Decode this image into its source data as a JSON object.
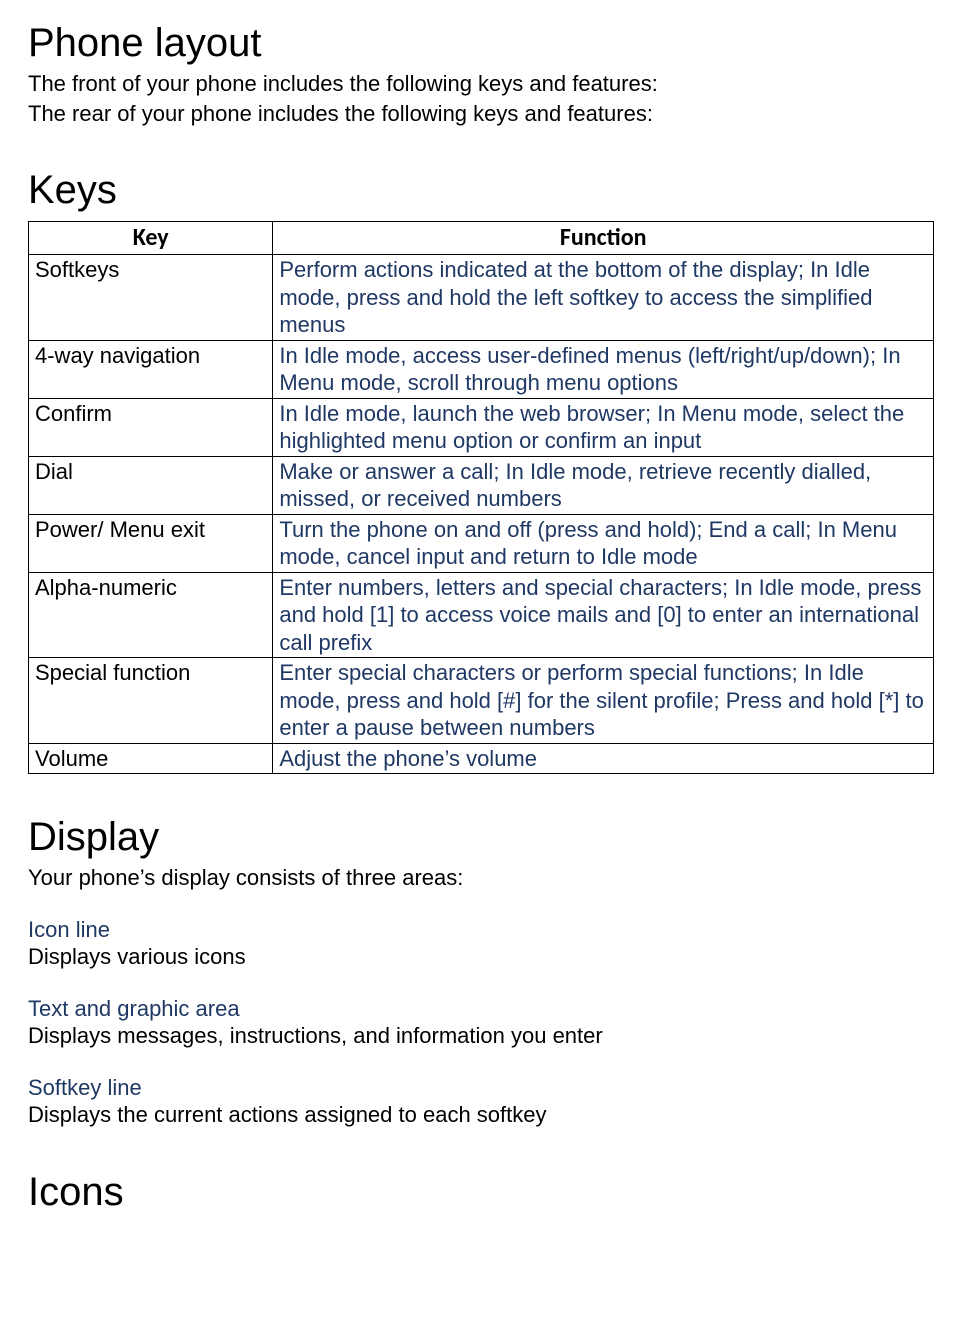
{
  "phone_layout": {
    "heading": "Phone layout",
    "p1": "The front of your phone includes the following keys and features:",
    "p2": "The rear of your phone includes the following keys and features:"
  },
  "keys": {
    "heading": "Keys",
    "table": {
      "header_key": "Key",
      "header_function": "Function",
      "rows": [
        {
          "key": "Softkeys",
          "function": "Perform actions indicated at the bottom of the display; In Idle mode, press and hold the left softkey to access the simplified menus"
        },
        {
          "key": "4-way navigation",
          "function": "In Idle mode, access user-defined menus (left/right/up/down); In Menu mode, scroll through menu options"
        },
        {
          "key": "Confirm",
          "function": "In Idle mode, launch the web browser; In Menu mode, select the highlighted menu option or confirm an input"
        },
        {
          "key": "Dial",
          "function": "Make or answer a call; In Idle mode, retrieve recently dialled, missed, or received numbers"
        },
        {
          "key": "Power/ Menu exit",
          "function": "Turn the phone on and off (press and hold); End a call; In Menu mode, cancel input and return to Idle mode"
        },
        {
          "key": "Alpha-numeric",
          "function": "Enter numbers, letters and special characters; In Idle mode, press and hold [1] to access voice mails and [0] to enter an international call prefix"
        },
        {
          "key": "Special function",
          "function": "Enter special characters or perform special functions; In Idle mode, press and hold [#] for the silent profile; Press and hold [*] to enter a pause between numbers"
        },
        {
          "key": "Volume",
          "function": "Adjust the phone’s volume"
        }
      ]
    }
  },
  "display": {
    "heading": "Display",
    "intro": "Your phone’s display consists of three areas:",
    "areas": [
      {
        "label": "Icon line",
        "desc": "Displays various icons"
      },
      {
        "label": "Text and graphic area",
        "desc": "Displays messages, instructions, and information you enter"
      },
      {
        "label": "Softkey line",
        "desc": "Displays the current actions assigned to each softkey"
      }
    ]
  },
  "icons": {
    "heading": "Icons"
  }
}
